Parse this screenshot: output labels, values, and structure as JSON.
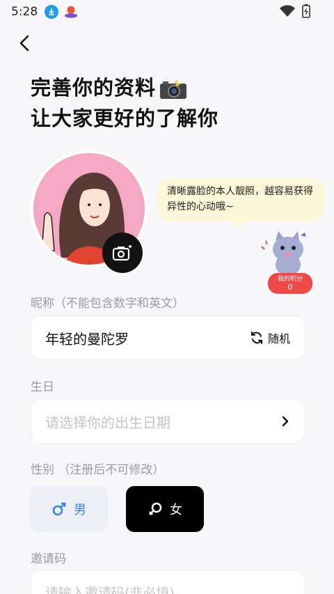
{
  "status": {
    "time": "5:28",
    "icons": [
      "download-icon",
      "app-icon",
      "wifi-icon",
      "battery-icon"
    ]
  },
  "title": {
    "line1": "完善你的资料",
    "line2": "让大家更好的了解你",
    "emoji": "camera-flash-emoji"
  },
  "tip": {
    "text": "清晰露脸的本人靓照，越容易获得异性的心动哦~"
  },
  "points": {
    "label": "我的积分",
    "value": "0"
  },
  "nickname": {
    "label": "昵称（不能包含数字和英文）",
    "value": "年轻的曼陀罗",
    "random_label": "随机"
  },
  "birthday": {
    "label": "生日",
    "placeholder": "请选择你的出生日期"
  },
  "gender": {
    "label": "性别 （注册后不可修改）",
    "male": "男",
    "female": "女",
    "selected": "female"
  },
  "invite": {
    "label": "邀请码",
    "placeholder": "请输入邀请码(非必填)"
  },
  "colors": {
    "accent_blue": "#3b82f6",
    "selected_black": "#000000",
    "badge_red": "#f04848",
    "bubble_yellow": "#fdf7d9",
    "avatar_pink": "#f5a8c4"
  }
}
